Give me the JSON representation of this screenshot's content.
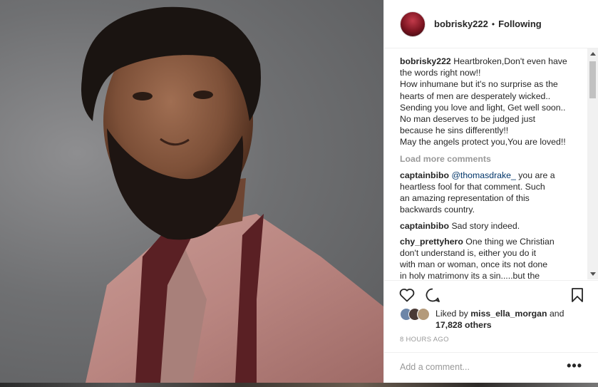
{
  "post": {
    "username": "bobrisky222",
    "follow_status": "Following",
    "dot": "•"
  },
  "caption": {
    "username": "bobrisky222",
    "lines": [
      "Heartbroken,Don't even have",
      "the words right now!!",
      "How inhumane but it's no surprise as the",
      "hearts of men are desperately wicked..",
      "Sending you love and light, Get well soon..",
      "No man deserves to be judged just",
      "because he sins differently!!",
      "May the angels protect you,You are loved!!"
    ]
  },
  "load_more": "Load more comments",
  "comments": [
    {
      "username": "captainbibo",
      "mention": "@thomasdrake_",
      "lines": [
        " you are a",
        "heartless fool for that comment. Such",
        "an amazing representation of this",
        "backwards country."
      ]
    },
    {
      "username": "captainbibo",
      "text": "Sad story indeed."
    },
    {
      "username": "chy_prettyhero",
      "lines": [
        "One thing we Christian",
        "don't understand is, either you do it",
        "with man or woman, once its not done",
        "in holy matrimony its a sin.....but the"
      ]
    }
  ],
  "likes": {
    "prefix": "Liked by ",
    "user": "miss_ella_morgan",
    "and": " and",
    "others": "17,828 others"
  },
  "timestamp": "8 HOURS AGO",
  "add_comment_placeholder": "Add a comment...",
  "more_options": "•••",
  "icons": {
    "like": "heart-icon",
    "comment": "comment-icon",
    "save": "bookmark-icon"
  },
  "colors": {
    "mention": "#003569",
    "muted": "#999999",
    "text": "#262626"
  }
}
